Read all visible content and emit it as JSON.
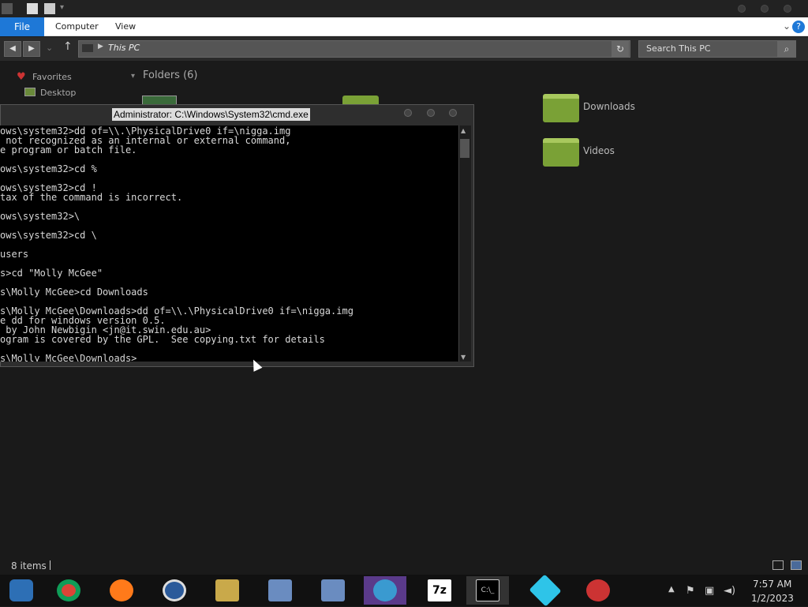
{
  "ribbon": {
    "file": "File",
    "computer": "Computer",
    "view": "View"
  },
  "address": {
    "text": "This PC"
  },
  "search": {
    "placeholder": "Search This PC"
  },
  "sidebar": {
    "favorites": "Favorites",
    "desktop": "Desktop"
  },
  "folders": {
    "header": "Folders (6)",
    "downloads": "Downloads",
    "videos": "Videos"
  },
  "cmd": {
    "title": "Administrator: C:\\Windows\\System32\\cmd.exe",
    "lines": [
      "ows\\system32>dd of=\\\\.\\PhysicalDrive0 if=\\nigga.img",
      " not recognized as an internal or external command,",
      "e program or batch file.",
      "",
      "ows\\system32>cd %",
      "",
      "ows\\system32>cd !",
      "tax of the command is incorrect.",
      "",
      "ows\\system32>\\",
      "",
      "ows\\system32>cd \\",
      "",
      "users",
      "",
      "s>cd \"Molly McGee\"",
      "",
      "s\\Molly McGee>cd Downloads",
      "",
      "s\\Molly McGee\\Downloads>dd of=\\\\.\\PhysicalDrive0 if=\\nigga.img",
      "e dd for windows version 0.5.",
      " by John Newbigin <jn@it.swin.edu.au>",
      "ogram is covered by the GPL.  See copying.txt for details",
      "",
      "s\\Molly McGee\\Downloads>"
    ]
  },
  "status": {
    "items": "8 items"
  },
  "clock": {
    "time": "7:57 AM",
    "date": "1/2/2023"
  },
  "icons": {
    "taskbar": [
      "start-orb-icon",
      "chrome-icon",
      "firefox-icon",
      "opera-icon",
      "file-explorer-icon",
      "network-setup-icon",
      "network-setup-icon-2",
      "people-app-icon",
      "7zip-icon",
      "cmd-icon",
      "diamond-app-icon",
      "game-app-icon"
    ]
  },
  "colors": {
    "accent": "#1e78d7",
    "folder": "#7aa136"
  }
}
